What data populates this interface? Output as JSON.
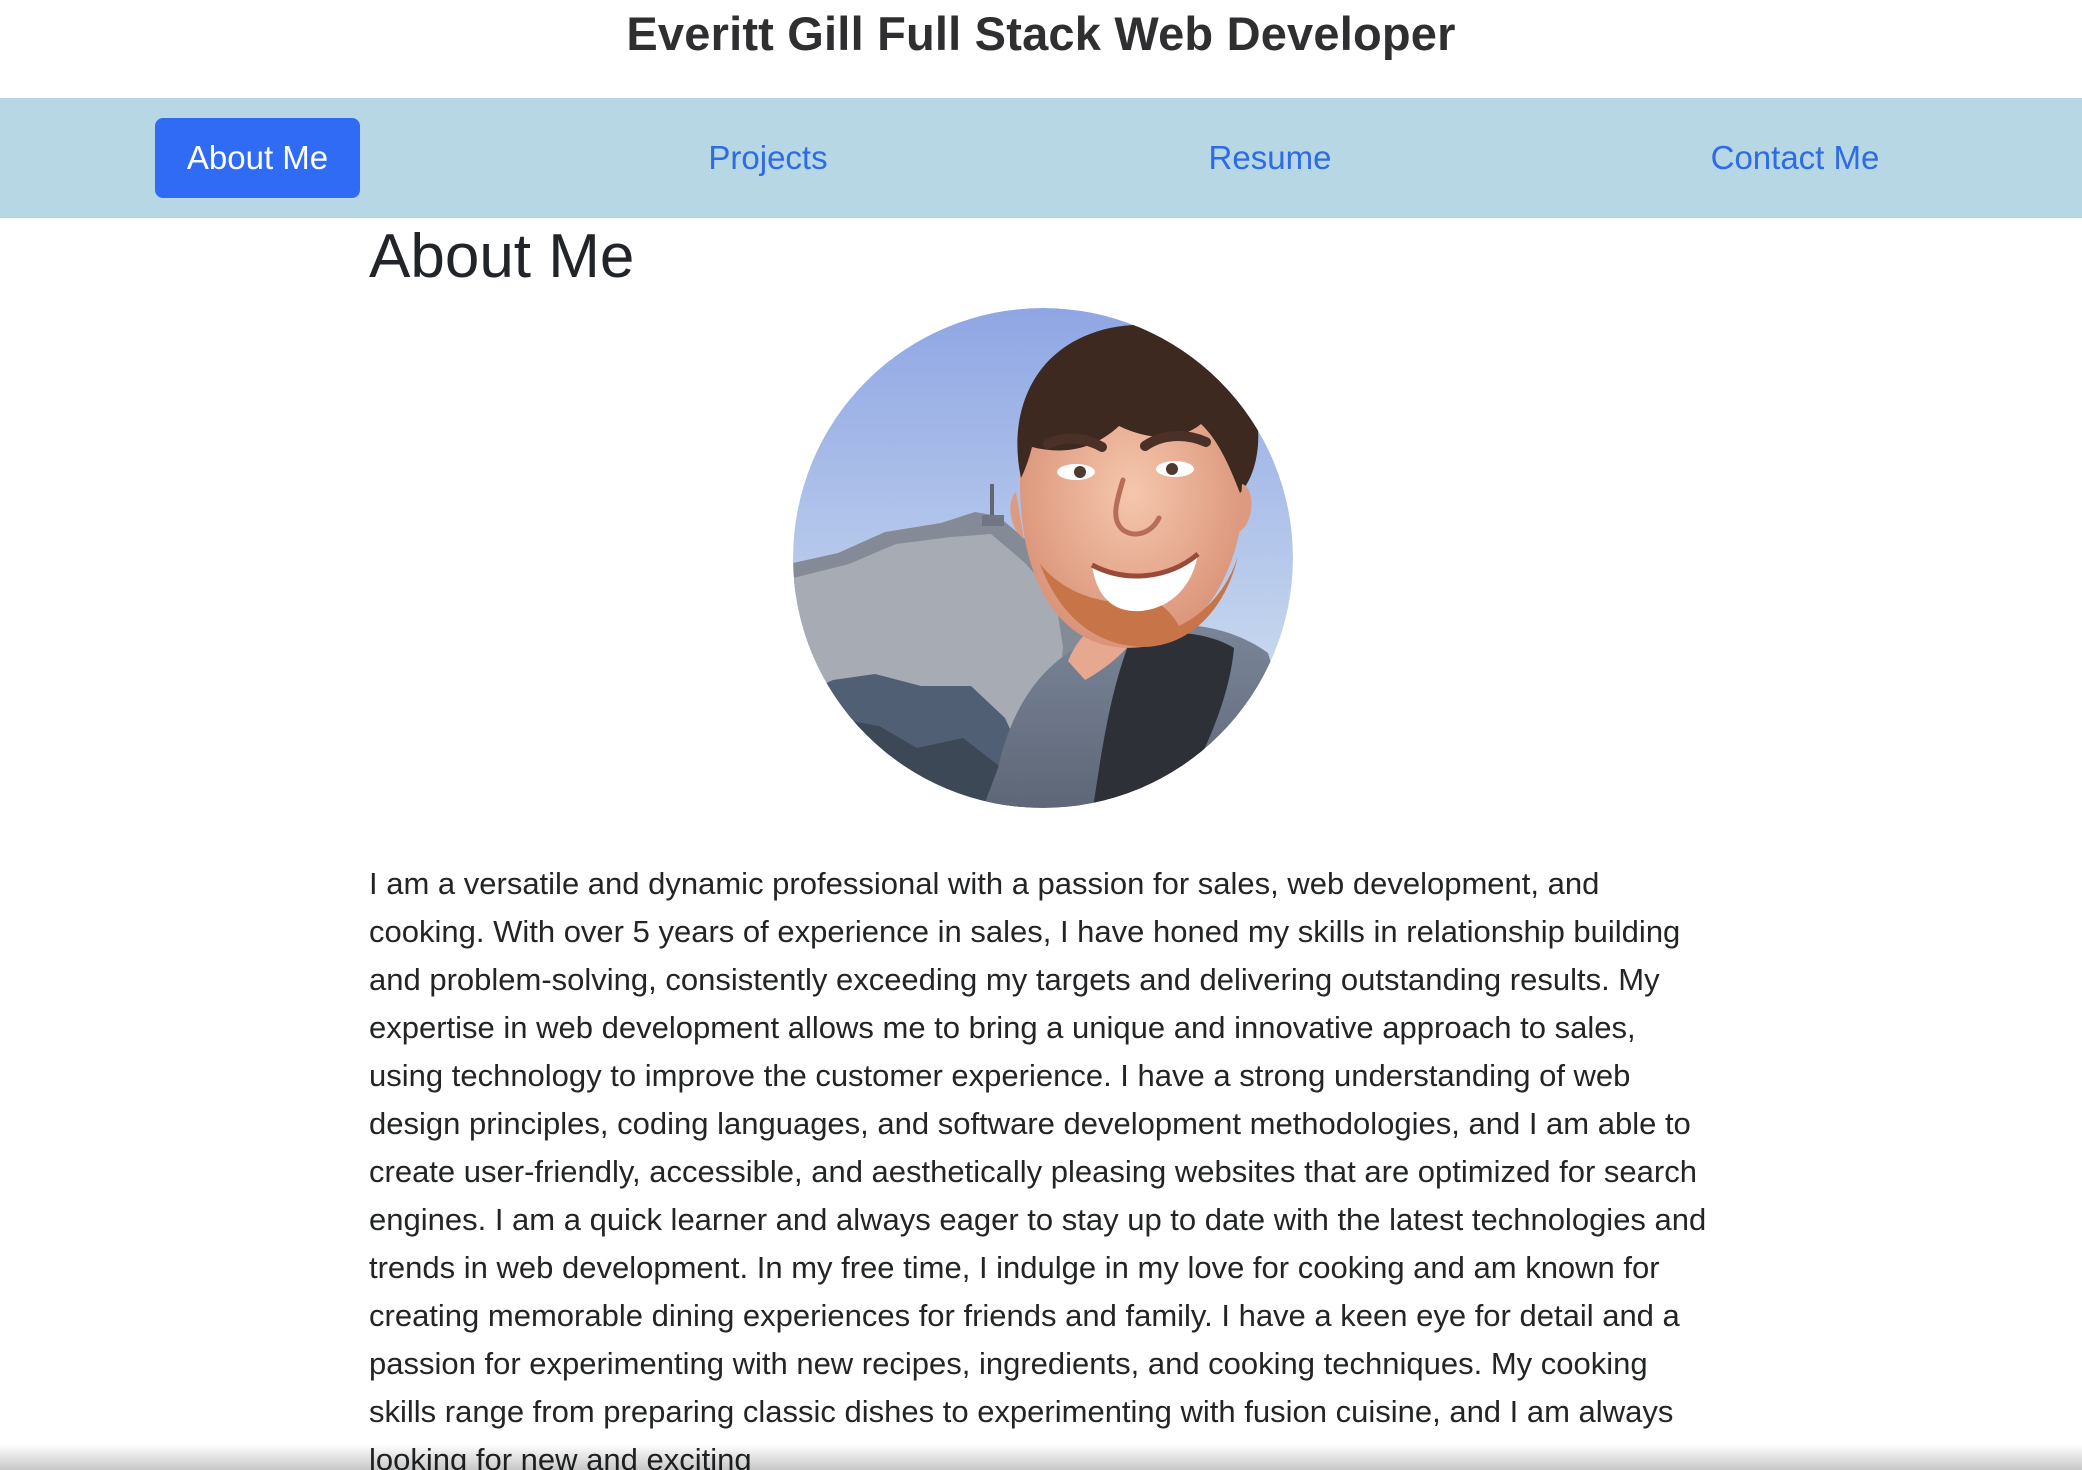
{
  "header": {
    "title": "Everitt Gill Full Stack Web Developer"
  },
  "nav": {
    "items": [
      {
        "label": "About Me",
        "active": true
      },
      {
        "label": "Projects",
        "active": false
      },
      {
        "label": "Resume",
        "active": false
      },
      {
        "label": "Contact Me",
        "active": false
      }
    ]
  },
  "main": {
    "section_title": "About Me",
    "bio": "I am a versatile and dynamic professional with a passion for sales, web development, and cooking. With over 5 years of experience in sales, I have honed my skills in relationship building and problem-solving, consistently exceeding my targets and delivering outstanding results. My expertise in web development allows me to bring a unique and innovative approach to sales, using technology to improve the customer experience. I have a strong understanding of web design principles, coding languages, and software development methodologies, and I am able to create user-friendly, accessible, and aesthetically pleasing websites that are optimized for search engines. I am a quick learner and always eager to stay up to date with the latest technologies and trends in web development. In my free time, I indulge in my love for cooking and am known for creating memorable dining experiences for friends and family. I have a keen eye for detail and a passion for experimenting with new recipes, ingredients, and cooking techniques. My cooking skills range from preparing classic dishes to experimenting with fusion cuisine, and I am always looking for new and exciting"
  },
  "colors": {
    "nav_background": "#b6d7e3",
    "active_button": "#2f6bf5",
    "link": "#2e6be6"
  }
}
